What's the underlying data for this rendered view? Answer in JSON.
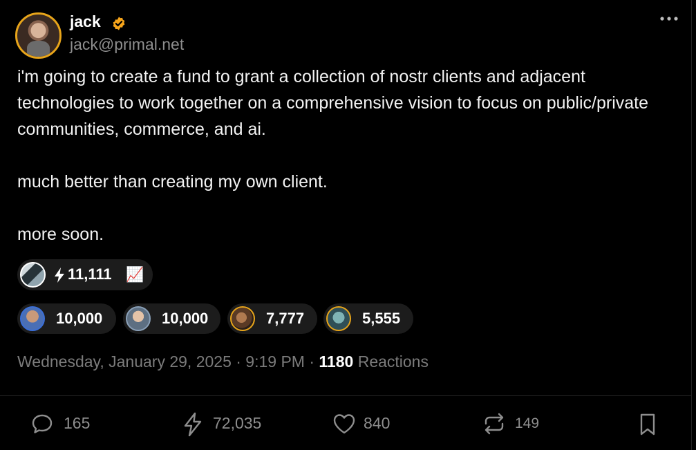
{
  "author": {
    "name": "jack",
    "handle": "jack@primal.net",
    "verified_color": "#f7a51b"
  },
  "post": {
    "paragraphs": [
      "i'm going to create a fund to grant a collection of nostr clients and adjacent technologies to work together on a comprehensive vision to focus on public/private communities, commerce, and ai.",
      "much better than creating my own client.",
      "more soon."
    ]
  },
  "top_zap": {
    "amount": "11,111",
    "emoji": "📈"
  },
  "zaps": [
    {
      "amount": "10,000"
    },
    {
      "amount": "10,000"
    },
    {
      "amount": "7,777"
    },
    {
      "amount": "5,555"
    }
  ],
  "meta": {
    "timestamp": "Wednesday, January 29, 2025 · 9:19 PM · ",
    "reaction_count": "1180",
    "reaction_label": " Reactions"
  },
  "actions": {
    "replies": "165",
    "zaps": "72,035",
    "likes": "840",
    "reposts": "149"
  },
  "icons": {
    "more": "more-horizontal-icon",
    "reply": "reply-icon",
    "zap": "lightning-icon",
    "like": "heart-icon",
    "repost": "repost-icon",
    "bookmark": "bookmark-icon"
  },
  "colors": {
    "background": "#000000",
    "muted": "#8e8e8e",
    "pill": "#1c1c1c",
    "accent": "#e8a51a"
  }
}
